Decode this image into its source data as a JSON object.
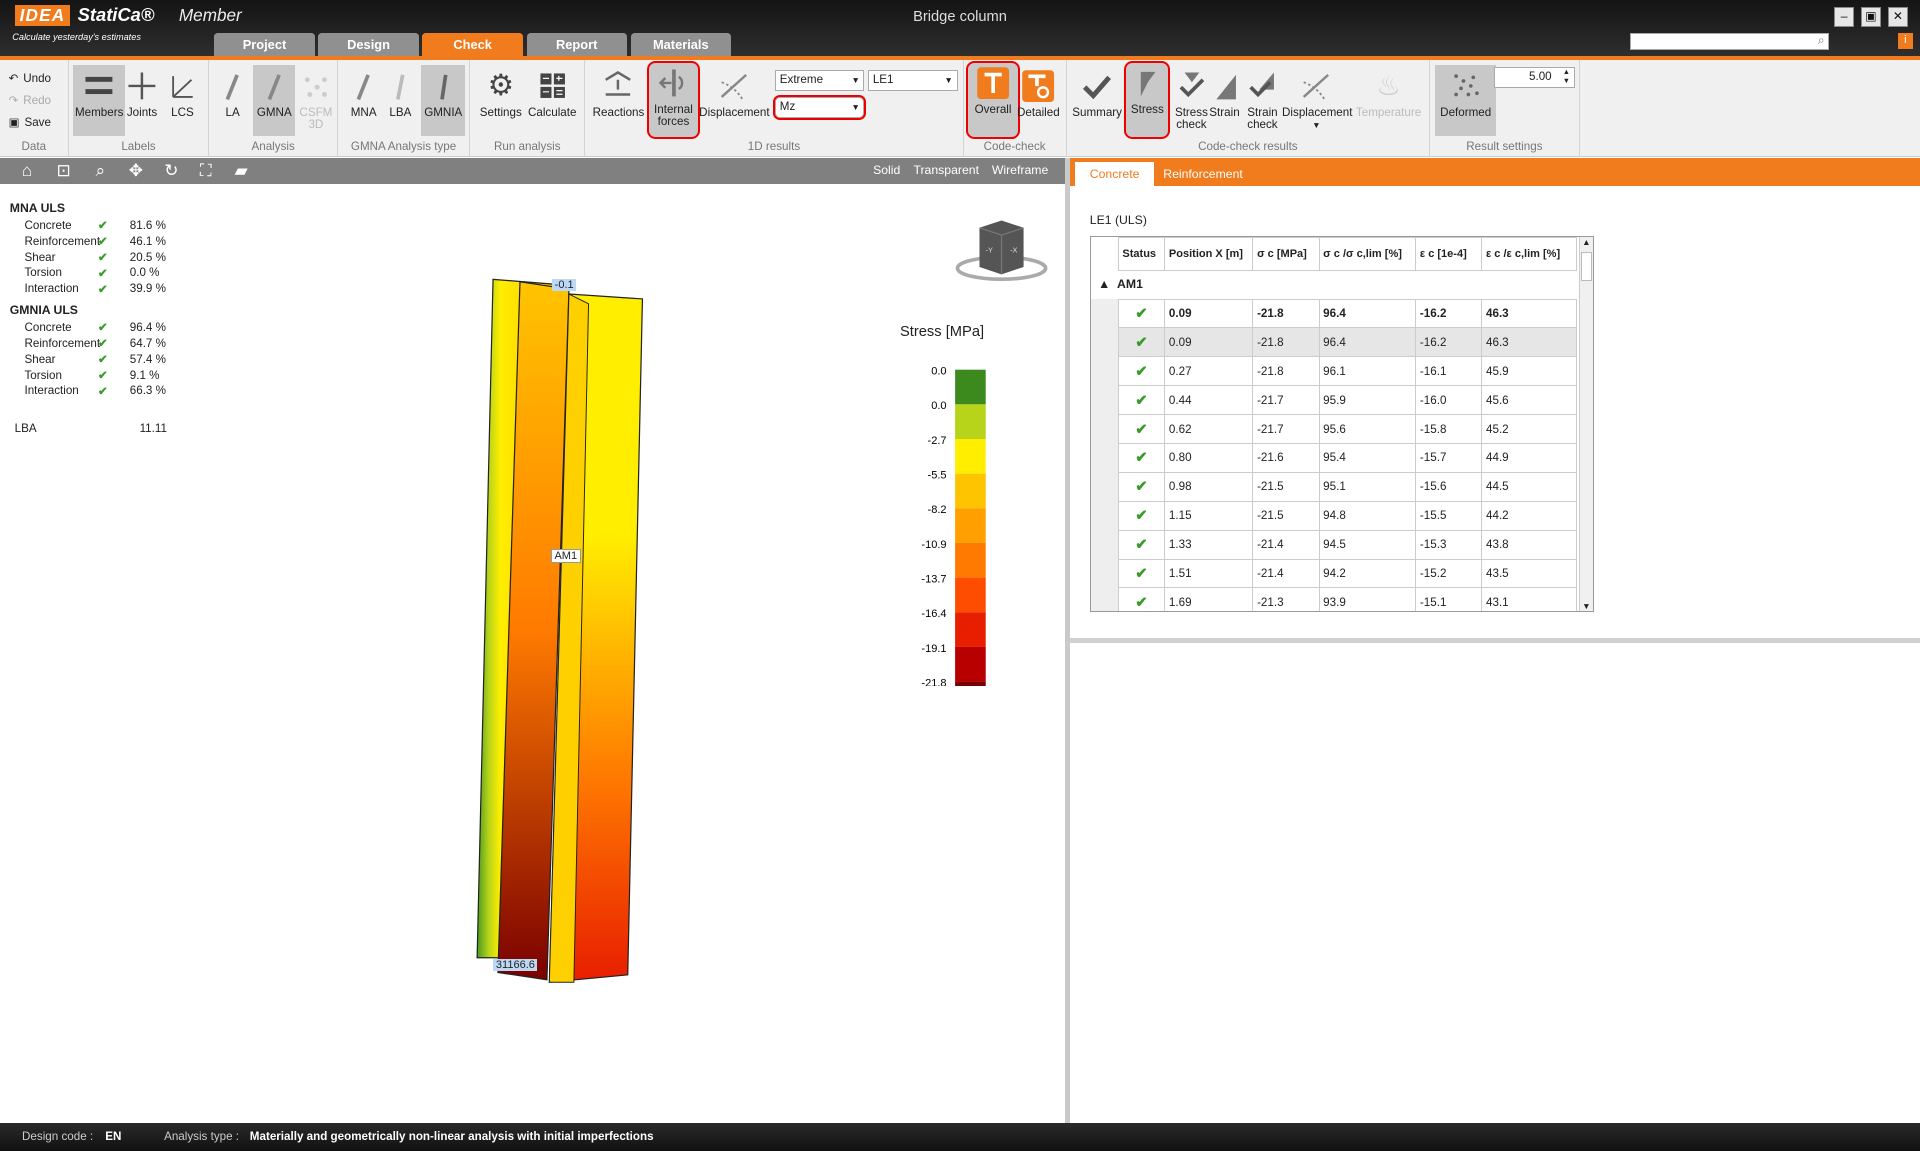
{
  "app": {
    "brand_idea": "IDEA",
    "brand_statica": "StatiCa®",
    "product": "Member",
    "tagline": "Calculate yesterday's estimates",
    "window_title": "Bridge column"
  },
  "tabs": [
    "Project",
    "Design",
    "Check",
    "Report",
    "Materials"
  ],
  "ribbon": {
    "data": {
      "label": "Data",
      "undo": "Undo",
      "redo": "Redo",
      "save": "Save"
    },
    "labels": {
      "label": "Labels",
      "members": "Members",
      "joints": "Joints",
      "lcs": "LCS"
    },
    "analysis": {
      "label": "Analysis",
      "la": "LA",
      "gmna": "GMNA",
      "csfm": "CSFM 3D",
      "csfm_tag": "3D"
    },
    "gmna_type": {
      "label": "GMNA Analysis type",
      "mna": "MNA",
      "lba": "LBA",
      "gmnia": "GMNIA"
    },
    "run": {
      "label": "Run analysis",
      "settings": "Settings",
      "calculate": "Calculate"
    },
    "one_d": {
      "label": "1D results",
      "reactions": "Reactions",
      "internal_forces": "Internal forces",
      "displacement": "Displacement",
      "extreme": "Extreme",
      "le": "LE1",
      "component": "Mz"
    },
    "code_check": {
      "label": "Code-check",
      "overall": "Overall",
      "detailed": "Detailed"
    },
    "cc_results": {
      "label": "Code-check results",
      "summary": "Summary",
      "stress": "Stress",
      "stress_check": "Stress check",
      "strain": "Strain",
      "strain_check": "Strain check",
      "displacement": "Displacement",
      "temperature": "Temperature"
    },
    "result_settings": {
      "label": "Result settings",
      "deformed": "Deformed",
      "scale": "5.00"
    }
  },
  "view_modes": [
    "Solid",
    "Transparent",
    "Wireframe"
  ],
  "mna": {
    "title": "MNA ULS",
    "rows": [
      {
        "k": "Concrete",
        "v": "81.6 %"
      },
      {
        "k": "Reinforcement",
        "v": "46.1 %"
      },
      {
        "k": "Shear",
        "v": "20.5 %"
      },
      {
        "k": "Torsion",
        "v": "0.0 %"
      },
      {
        "k": "Interaction",
        "v": "39.9 %"
      }
    ]
  },
  "gmnia": {
    "title": "GMNIA ULS",
    "rows": [
      {
        "k": "Concrete",
        "v": "96.4 %"
      },
      {
        "k": "Reinforcement",
        "v": "64.7 %"
      },
      {
        "k": "Shear",
        "v": "57.4 %"
      },
      {
        "k": "Torsion",
        "v": "9.1 %"
      },
      {
        "k": "Interaction",
        "v": "66.3 %"
      }
    ]
  },
  "lba": {
    "k": "LBA",
    "v": "11.11"
  },
  "model": {
    "top_label": "-0.1",
    "mid_label": "AM1",
    "bottom_label": "31166.6"
  },
  "legend": {
    "title": "Stress [MPa]",
    "values": [
      "0.0",
      "0.0",
      "-2.7",
      "-5.5",
      "-8.2",
      "-10.9",
      "-13.7",
      "-16.4",
      "-19.1",
      "-21.8"
    ],
    "colors": [
      "#3c8a1e",
      "#b7d41a",
      "#ffee00",
      "#ffc400",
      "#ffa000",
      "#ff7a00",
      "#ff4d00",
      "#e81e00",
      "#b80000",
      "#7a0000"
    ]
  },
  "right_tabs": [
    "Concrete",
    "Reinforcement"
  ],
  "table": {
    "caption": "LE1 (ULS)",
    "group": "AM1",
    "headers": [
      "Status",
      "Position X [m]",
      "σ c  [MPa]",
      "σ c /σ c,lim  [%]",
      "ε c  [1e-4]",
      "ε c /ε c,lim  [%]"
    ],
    "rows": [
      [
        "✔",
        "0.09",
        "-21.8",
        "96.4",
        "-16.2",
        "46.3"
      ],
      [
        "✔",
        "0.09",
        "-21.8",
        "96.4",
        "-16.2",
        "46.3"
      ],
      [
        "✔",
        "0.27",
        "-21.8",
        "96.1",
        "-16.1",
        "45.9"
      ],
      [
        "✔",
        "0.44",
        "-21.7",
        "95.9",
        "-16.0",
        "45.6"
      ],
      [
        "✔",
        "0.62",
        "-21.7",
        "95.6",
        "-15.8",
        "45.2"
      ],
      [
        "✔",
        "0.80",
        "-21.6",
        "95.4",
        "-15.7",
        "44.9"
      ],
      [
        "✔",
        "0.98",
        "-21.5",
        "95.1",
        "-15.6",
        "44.5"
      ],
      [
        "✔",
        "1.15",
        "-21.5",
        "94.8",
        "-15.5",
        "44.2"
      ],
      [
        "✔",
        "1.33",
        "-21.4",
        "94.5",
        "-15.3",
        "43.8"
      ],
      [
        "✔",
        "1.51",
        "-21.4",
        "94.2",
        "-15.2",
        "43.5"
      ],
      [
        "✔",
        "1.69",
        "-21.3",
        "93.9",
        "-15.1",
        "43.1"
      ]
    ]
  },
  "status": {
    "design_code_label": "Design code :",
    "design_code": "EN",
    "analysis_type_label": "Analysis type :",
    "analysis_type": "Materially and geometrically non-linear analysis with initial imperfections"
  }
}
